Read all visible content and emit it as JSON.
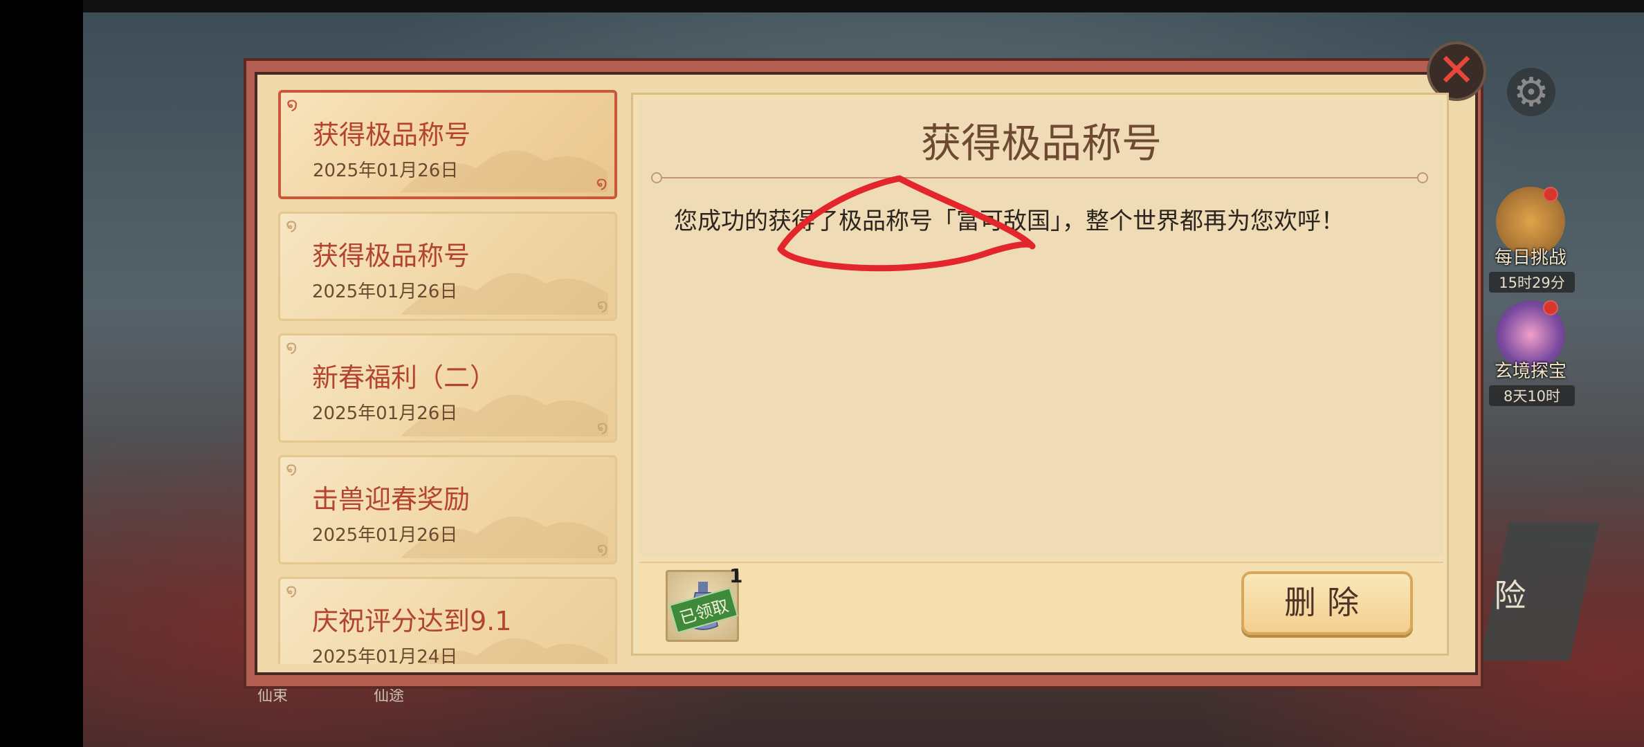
{
  "mail_list": [
    {
      "title": "获得极品称号",
      "date": "2025年01月26日",
      "active": true
    },
    {
      "title": "获得极品称号",
      "date": "2025年01月26日",
      "active": false
    },
    {
      "title": "新春福利（二）",
      "date": "2025年01月26日",
      "active": false
    },
    {
      "title": "击兽迎春奖励",
      "date": "2025年01月26日",
      "active": false
    },
    {
      "title": "庆祝评分达到9.1",
      "date": "2025年01月24日",
      "active": false
    }
  ],
  "mail": {
    "heading": "获得极品称号",
    "body": "您成功的获得了极品称号「富可敌国」，整个世界都再为您欢呼！",
    "reward": {
      "status_tag": "已领取",
      "count": "1",
      "icon": "flask-icon"
    },
    "delete_label": "删除"
  },
  "close_icon": "close-icon",
  "side_icons": [
    {
      "title": "每日挑战",
      "timer": "15时29分"
    },
    {
      "title": "玄境探宝",
      "timer": "8天10时"
    }
  ],
  "background": {
    "bottom_labels": [
      "仙束",
      "仙途"
    ],
    "adventure_fragment": "险"
  },
  "colors": {
    "accent_red": "#c9583b",
    "panel_bg": "#f3dfb4",
    "frame": "#b35f52",
    "reward_tag_green": "#3e8a3a",
    "annotation_red": "#e3262c"
  }
}
